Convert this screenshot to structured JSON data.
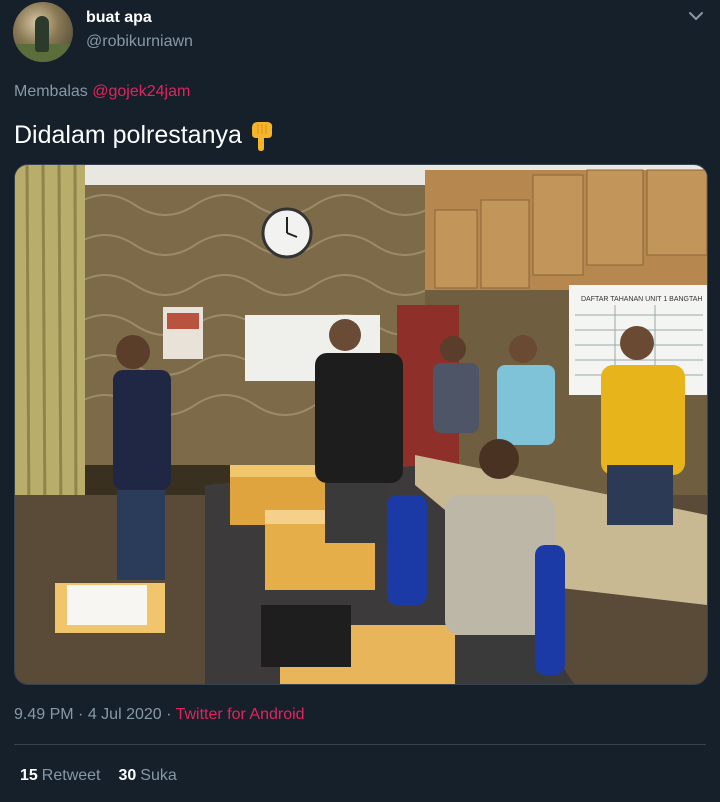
{
  "user": {
    "display_name": "buat apa",
    "handle": "@robikurniawn"
  },
  "reply": {
    "prefix": "Membalas",
    "mention": "@gojek24jam"
  },
  "tweet": {
    "text": "Didalam polrestanya",
    "emoji_icon": "backhand-index-pointing-down"
  },
  "photo": {
    "board_title": "DAFTAR TAHANAN UNIT 1 BANGTAH"
  },
  "meta": {
    "time": "9.49 PM",
    "separator1": "·",
    "date": "4 Jul 2020",
    "separator2": "·",
    "source": "Twitter for Android"
  },
  "stats": {
    "retweets_count": "15",
    "retweets_label": "Retweet",
    "likes_count": "30",
    "likes_label": "Suka"
  },
  "colors": {
    "background": "#15202b",
    "muted_text": "#8899a6",
    "link": "#e0245e",
    "divider": "#38444d"
  }
}
